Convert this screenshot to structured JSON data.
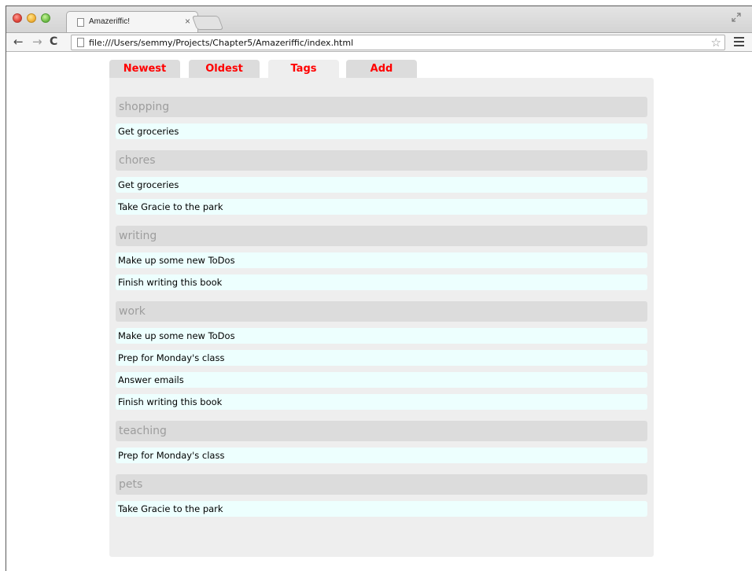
{
  "browser": {
    "tab_title": "Amazeriffic!",
    "tab_close": "×",
    "url": "file:///Users/semmy/Projects/Chapter5/Amazeriffic/index.html",
    "back": "←",
    "forward": "→",
    "reload": "C",
    "star": "☆"
  },
  "app_tabs": [
    {
      "label": "Newest"
    },
    {
      "label": "Oldest"
    },
    {
      "label": "Tags",
      "active": true
    },
    {
      "label": "Add"
    }
  ],
  "tag_groups": [
    {
      "name": "shopping",
      "items": [
        "Get groceries"
      ]
    },
    {
      "name": "chores",
      "items": [
        "Get groceries",
        "Take Gracie to the park"
      ]
    },
    {
      "name": "writing",
      "items": [
        "Make up some new ToDos",
        "Finish writing this book"
      ]
    },
    {
      "name": "work",
      "items": [
        "Make up some new ToDos",
        "Prep for Monday's class",
        "Answer emails",
        "Finish writing this book"
      ]
    },
    {
      "name": "teaching",
      "items": [
        "Prep for Monday's class"
      ]
    },
    {
      "name": "pets",
      "items": [
        "Take Gracie to the park"
      ]
    }
  ],
  "colors": {
    "tab_text": "#ff0000",
    "tag_header_bg": "#dcdcdc",
    "todo_bg": "#edfffe",
    "panel_bg": "#eeeeee"
  }
}
